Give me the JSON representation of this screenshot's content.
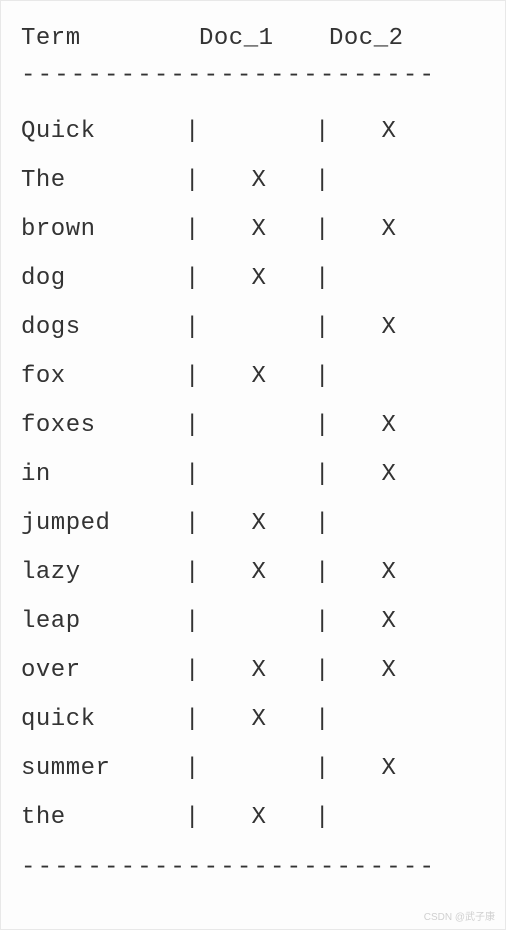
{
  "chart_data": {
    "type": "table",
    "title": "",
    "columns": [
      "Term",
      "Doc_1",
      "Doc_2"
    ],
    "rows": [
      {
        "term": "Quick",
        "doc1": "",
        "doc2": "X"
      },
      {
        "term": "The",
        "doc1": "X",
        "doc2": ""
      },
      {
        "term": "brown",
        "doc1": "X",
        "doc2": "X"
      },
      {
        "term": "dog",
        "doc1": "X",
        "doc2": ""
      },
      {
        "term": "dogs",
        "doc1": "",
        "doc2": "X"
      },
      {
        "term": "fox",
        "doc1": "X",
        "doc2": ""
      },
      {
        "term": "foxes",
        "doc1": "",
        "doc2": "X"
      },
      {
        "term": "in",
        "doc1": "",
        "doc2": "X"
      },
      {
        "term": "jumped",
        "doc1": "X",
        "doc2": ""
      },
      {
        "term": "lazy",
        "doc1": "X",
        "doc2": "X"
      },
      {
        "term": "leap",
        "doc1": "",
        "doc2": "X"
      },
      {
        "term": "over",
        "doc1": "X",
        "doc2": "X"
      },
      {
        "term": "quick",
        "doc1": "X",
        "doc2": ""
      },
      {
        "term": "summer",
        "doc1": "",
        "doc2": "X"
      },
      {
        "term": "the",
        "doc1": "X",
        "doc2": ""
      }
    ]
  },
  "header": {
    "term": "Term",
    "doc1": "Doc_1",
    "doc2": "Doc_2"
  },
  "divider": "-------------------------",
  "pipe": "|",
  "watermark": "CSDN @武子康"
}
